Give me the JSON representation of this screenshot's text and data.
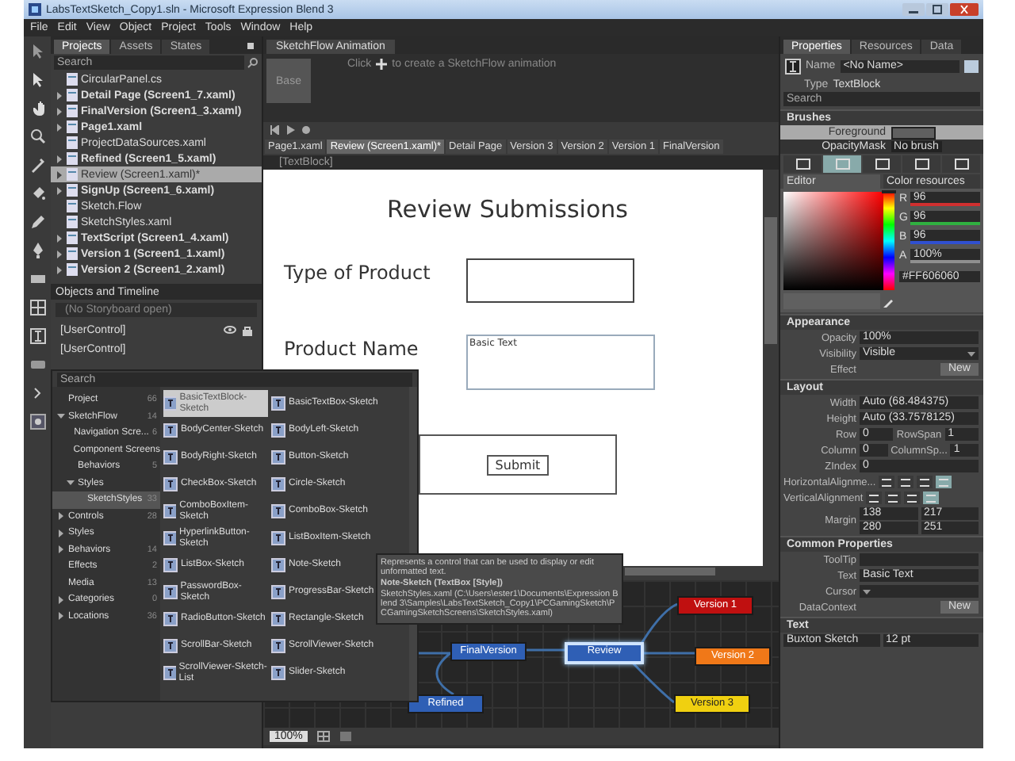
{
  "window": {
    "title": "LabsTextSketch_Copy1.sln - Microsoft Expression Blend 3"
  },
  "menu": [
    "File",
    "Edit",
    "View",
    "Object",
    "Project",
    "Tools",
    "Window",
    "Help"
  ],
  "projects_panel": {
    "tabs": [
      {
        "label": "Projects",
        "selected": true
      },
      {
        "label": "Assets",
        "selected": false
      },
      {
        "label": "States",
        "selected": false
      }
    ],
    "search": {
      "placeholder": "Search"
    },
    "items": [
      {
        "label": "CircularPanel.cs",
        "bold": false,
        "expandable": false,
        "selected": false
      },
      {
        "label": "Detail Page (Screen1_7.xaml)",
        "bold": true,
        "expandable": true,
        "selected": false
      },
      {
        "label": "FinalVersion (Screen1_3.xaml)",
        "bold": true,
        "expandable": true,
        "selected": false
      },
      {
        "label": "Page1.xaml",
        "bold": true,
        "expandable": true,
        "selected": false
      },
      {
        "label": "ProjectDataSources.xaml",
        "bold": false,
        "expandable": false,
        "selected": false
      },
      {
        "label": "Refined (Screen1_5.xaml)",
        "bold": true,
        "expandable": true,
        "selected": false
      },
      {
        "label": "Review (Screen1.xaml)*",
        "bold": false,
        "expandable": true,
        "selected": true
      },
      {
        "label": "SignUp (Screen1_6.xaml)",
        "bold": true,
        "expandable": true,
        "selected": false
      },
      {
        "label": "Sketch.Flow",
        "bold": false,
        "expandable": false,
        "selected": false
      },
      {
        "label": "SketchStyles.xaml",
        "bold": false,
        "expandable": false,
        "selected": false
      },
      {
        "label": "TextScript (Screen1_4.xaml)",
        "bold": true,
        "expandable": true,
        "selected": false
      },
      {
        "label": "Version 1 (Screen1_1.xaml)",
        "bold": true,
        "expandable": true,
        "selected": false
      },
      {
        "label": "Version 2 (Screen1_2.xaml)",
        "bold": true,
        "expandable": true,
        "selected": false
      }
    ]
  },
  "objects_panel": {
    "title": "Objects and Timeline",
    "storyboard": "(No Storyboard open)",
    "scope": "[UserControl]",
    "tree": [
      "[UserControl]"
    ]
  },
  "animation_panel": {
    "title": "SketchFlow Animation",
    "base_tile": "Base",
    "click": "Click",
    "hint": "to create a SketchFlow animation"
  },
  "document_tabs": [
    {
      "label": "Page1.xaml",
      "selected": false
    },
    {
      "label": "Review (Screen1.xaml)*",
      "selected": true
    },
    {
      "label": "Detail Page",
      "selected": false
    },
    {
      "label": "Version 3",
      "selected": false
    },
    {
      "label": "Version 2",
      "selected": false
    },
    {
      "label": "Version 1",
      "selected": false
    },
    {
      "label": "FinalVersion",
      "selected": false
    }
  ],
  "breadcrumb": "[TextBlock]",
  "artboard": {
    "title": "Review Submissions",
    "labels": [
      "Type of Product",
      "Product Name"
    ],
    "text_box": "Basic Text",
    "button": "Submit"
  },
  "asset_popup": {
    "search": {
      "placeholder": "Search"
    },
    "categories": [
      {
        "label": "Project",
        "count": "66",
        "selected": false,
        "expandable": false
      },
      {
        "label": "SketchFlow",
        "count": "14",
        "selected": false,
        "expandable": true,
        "expanded": true,
        "children": [
          {
            "label": "Navigation Scre...",
            "count": "6",
            "selected": false,
            "expandable": false
          },
          {
            "label": "Component Screens",
            "selected": false,
            "expandable": false
          },
          {
            "label": "Behaviors",
            "count": "5",
            "selected": false,
            "expandable": false
          },
          {
            "label": "Styles",
            "selected": false,
            "expandable": true,
            "expanded": true,
            "children": [
              {
                "label": "SketchStyles",
                "count": "33",
                "selected": true,
                "expandable": false
              }
            ]
          }
        ]
      },
      {
        "label": "Controls",
        "count": "28",
        "selected": false,
        "expandable": true,
        "expanded": false
      },
      {
        "label": "Styles",
        "selected": false,
        "expandable": true,
        "expanded": false
      },
      {
        "label": "Behaviors",
        "count": "14",
        "selected": false,
        "expandable": true,
        "expanded": false
      },
      {
        "label": "Effects",
        "count": "2",
        "selected": false,
        "expandable": false
      },
      {
        "label": "Media",
        "count": "13",
        "selected": false,
        "expandable": false
      },
      {
        "label": "Categories",
        "count": "0",
        "selected": false,
        "expandable": true,
        "expanded": false
      },
      {
        "label": "Locations",
        "count": "36",
        "selected": false,
        "expandable": true,
        "expanded": false
      }
    ],
    "assets": [
      {
        "label": "BasicTextBlock-Sketch",
        "selected": true
      },
      {
        "label": "BasicTextBox-Sketch",
        "selected": false
      },
      {
        "label": "BodyCenter-Sketch",
        "selected": false
      },
      {
        "label": "BodyLeft-Sketch",
        "selected": false
      },
      {
        "label": "BodyRight-Sketch",
        "selected": false
      },
      {
        "label": "Button-Sketch",
        "selected": false
      },
      {
        "label": "CheckBox-Sketch",
        "selected": false
      },
      {
        "label": "Circle-Sketch",
        "selected": false
      },
      {
        "label": "ComboBoxItem-Sketch",
        "selected": false
      },
      {
        "label": "ComboBox-Sketch",
        "selected": false
      },
      {
        "label": "HyperlinkButton-Sketch",
        "selected": false
      },
      {
        "label": "ListBoxItem-Sketch",
        "selected": false
      },
      {
        "label": "ListBox-Sketch",
        "selected": false
      },
      {
        "label": "Note-Sketch",
        "selected": false
      },
      {
        "label": "PasswordBox-Sketch",
        "selected": false
      },
      {
        "label": "ProgressBar-Sketch",
        "selected": false
      },
      {
        "label": "RadioButton-Sketch",
        "selected": false
      },
      {
        "label": "Rectangle-Sketch",
        "selected": false
      },
      {
        "label": "ScrollBar-Sketch",
        "selected": false
      },
      {
        "label": "ScrollViewer-Sketch",
        "selected": false
      },
      {
        "label": "ScrollViewer-Sketch-List",
        "selected": false
      },
      {
        "label": "Slider-Sketch",
        "selected": false
      }
    ]
  },
  "tooltip": {
    "description": "Represents a control that can be used to display or edit unformatted text.",
    "title": "Note-Sketch (TextBox [Style])",
    "path": "SketchStyles.xaml (C:\\Users\\ester1\\Documents\\Expression Blend 3\\Samples\\LabsTextSketch_Copy1\\PCGamingSketch\\PCGamingSketchScreens\\SketchStyles.xaml)"
  },
  "flow_nodes": [
    {
      "label": "FinalVersion",
      "color": "#2f5fb5",
      "selected": false
    },
    {
      "label": "Review",
      "color": "#2f5fb5",
      "selected": true
    },
    {
      "label": "Version 1",
      "color": "#c01010",
      "selected": false
    },
    {
      "label": "Version 2",
      "color": "#f07818",
      "selected": false
    },
    {
      "label": "Version 3",
      "color": "#f0d010",
      "selected": false
    },
    {
      "label": "Refined",
      "color": "#2f5fb5",
      "selected": false
    }
  ],
  "status_bar": {
    "zoom": "100%"
  },
  "properties": {
    "tabs": [
      {
        "label": "Properties",
        "selected": true
      },
      {
        "label": "Resources",
        "selected": false
      },
      {
        "label": "Data",
        "selected": false
      }
    ],
    "name_label": "Name",
    "name": "<No Name>",
    "type_label": "Type",
    "type": "TextBlock",
    "search": {
      "placeholder": "Search"
    },
    "brushes": {
      "title": "Brushes",
      "rows": [
        {
          "label": "Foreground",
          "selected": true
        },
        {
          "label": "OpacityMask",
          "selected": false,
          "value": "No brush"
        }
      ],
      "brush_types": [
        {
          "selected": false
        },
        {
          "selected": true
        },
        {
          "selected": false
        },
        {
          "selected": false
        },
        {
          "selected": false
        }
      ],
      "editor_tabs": [
        {
          "label": "Editor",
          "selected": true
        },
        {
          "label": "Color resources",
          "selected": false
        }
      ],
      "hue_slider": {
        "level": 1
      },
      "channels": [
        {
          "label": "R",
          "value": "96",
          "color": "#d03030"
        },
        {
          "label": "G",
          "value": "96",
          "color": "#30b040"
        },
        {
          "label": "B",
          "value": "96",
          "color": "#3050d0"
        },
        {
          "label": "A",
          "value": "100%",
          "color": "#909090"
        }
      ],
      "hex": "#FF606060"
    },
    "sections": [
      {
        "title": "Appearance",
        "rows": [
          {
            "kind": "field",
            "label": "Opacity",
            "value": "100%"
          },
          {
            "kind": "dropdown",
            "label": "Visibility",
            "value": "Visible"
          },
          {
            "kind": "button",
            "label": "Effect",
            "value": "New"
          }
        ]
      },
      {
        "title": "Layout",
        "rows": [
          {
            "kind": "field",
            "label": "Width",
            "value": "Auto (68.484375)"
          },
          {
            "kind": "field",
            "label": "Height",
            "value": "Auto (33.7578125)"
          },
          {
            "kind": "pair",
            "label": "Row",
            "value": "0",
            "label2": "RowSpan",
            "value2": "1"
          },
          {
            "kind": "pair",
            "label": "Column",
            "value": "0",
            "label2": "ColumnSp...",
            "value2": "1"
          },
          {
            "kind": "field",
            "label": "ZIndex",
            "value": "0"
          },
          {
            "kind": "align",
            "label": "HorizontalAlignme...",
            "options": [
              {
                "selected": false
              },
              {
                "selected": false
              },
              {
                "selected": false
              },
              {
                "selected": true
              }
            ]
          },
          {
            "kind": "align",
            "label": "VerticalAlignment",
            "options": [
              {
                "selected": false
              },
              {
                "selected": false
              },
              {
                "selected": false
              },
              {
                "selected": true
              }
            ]
          },
          {
            "kind": "margin",
            "label": "Margin",
            "values": [
              "138",
              "217",
              "280",
              "251"
            ]
          }
        ]
      },
      {
        "title": "Common Properties",
        "rows": [
          {
            "kind": "field",
            "label": "ToolTip"
          },
          {
            "kind": "field",
            "label": "Text",
            "value": "Basic Text"
          },
          {
            "kind": "dropdown",
            "label": "Cursor"
          },
          {
            "kind": "button",
            "label": "DataContext",
            "value": "New"
          }
        ]
      }
    ],
    "text_section": {
      "title": "Text",
      "font": "Buxton Sketch",
      "size": "12 pt"
    }
  }
}
